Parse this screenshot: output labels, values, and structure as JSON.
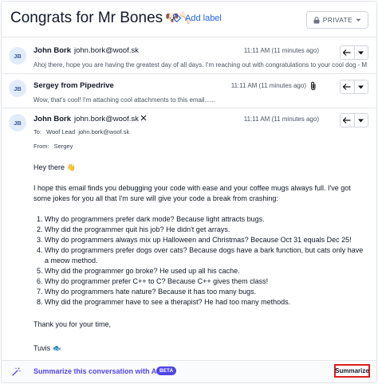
{
  "header": {
    "title": "Congrats for Mr Bones",
    "title_emoji": "🐶🦴",
    "add_label": "Add label",
    "visibility": "PRIVATE"
  },
  "messages": [
    {
      "avatar": "JB",
      "sender": "John Bork",
      "email": "john.bork@woof.sk",
      "time": "11:11 AM (11 minutes ago)",
      "snippet": "Ahoj there, hope you are having the greatest day of all days. I'm reaching out with congratulations to your cool dog - Mr.Bo"
    },
    {
      "avatar": "JB",
      "sender": "Sergey from Pipedrive",
      "time": "11:11 AM (11 minutes ago)",
      "snippet": "Wow, that's cool! I'm attaching cool attachments to this email......"
    }
  ],
  "expanded": {
    "avatar": "JB",
    "sender": "John Bork",
    "email": "john.bork@woof.sk",
    "time": "11:11 AM (11 minutes ago)",
    "to_label": "To:",
    "to_name": "Woof Lead",
    "to_email": "john.bork@woof.sk",
    "from_label": "From:",
    "from_name": "Sergey",
    "greeting": "Hey there",
    "greeting_emoji": "👋",
    "intro": "I hope this email finds you debugging your code with ease and your coffee mugs always full. I've got some jokes for you all that I'm sure will give your code a break from crashing:",
    "jokes": [
      "Why do programmers prefer dark mode? Because light attracts bugs.",
      "Why did the programmer quit his job? He didn't get arrays.",
      "Why do programmers always mix up Halloween and Christmas? Because Oct 31 equals Dec 25!",
      "Why do programmers prefer dogs over cats? Because dogs have a bark function, but cats only have a meow method.",
      "Why did the programmer go broke? He used up all his cache.",
      "Why do programmer prefer C++ to C? Because C++ gives them class!",
      "Why do programmers hate nature? Because it has too many bugs.",
      "Why did the programmer have to see a therapist? He had too many methods."
    ],
    "closing": "Thank you for your time,",
    "signature": "Tuvis",
    "signature_emoji": "🐟"
  },
  "footer": {
    "summarize_text": "Summarize this conversation with AI",
    "beta_badge": "BETA",
    "summarize_button": "Summarize",
    "accent_color": "#4f46e5",
    "highlight_color": "#e11d1d"
  }
}
